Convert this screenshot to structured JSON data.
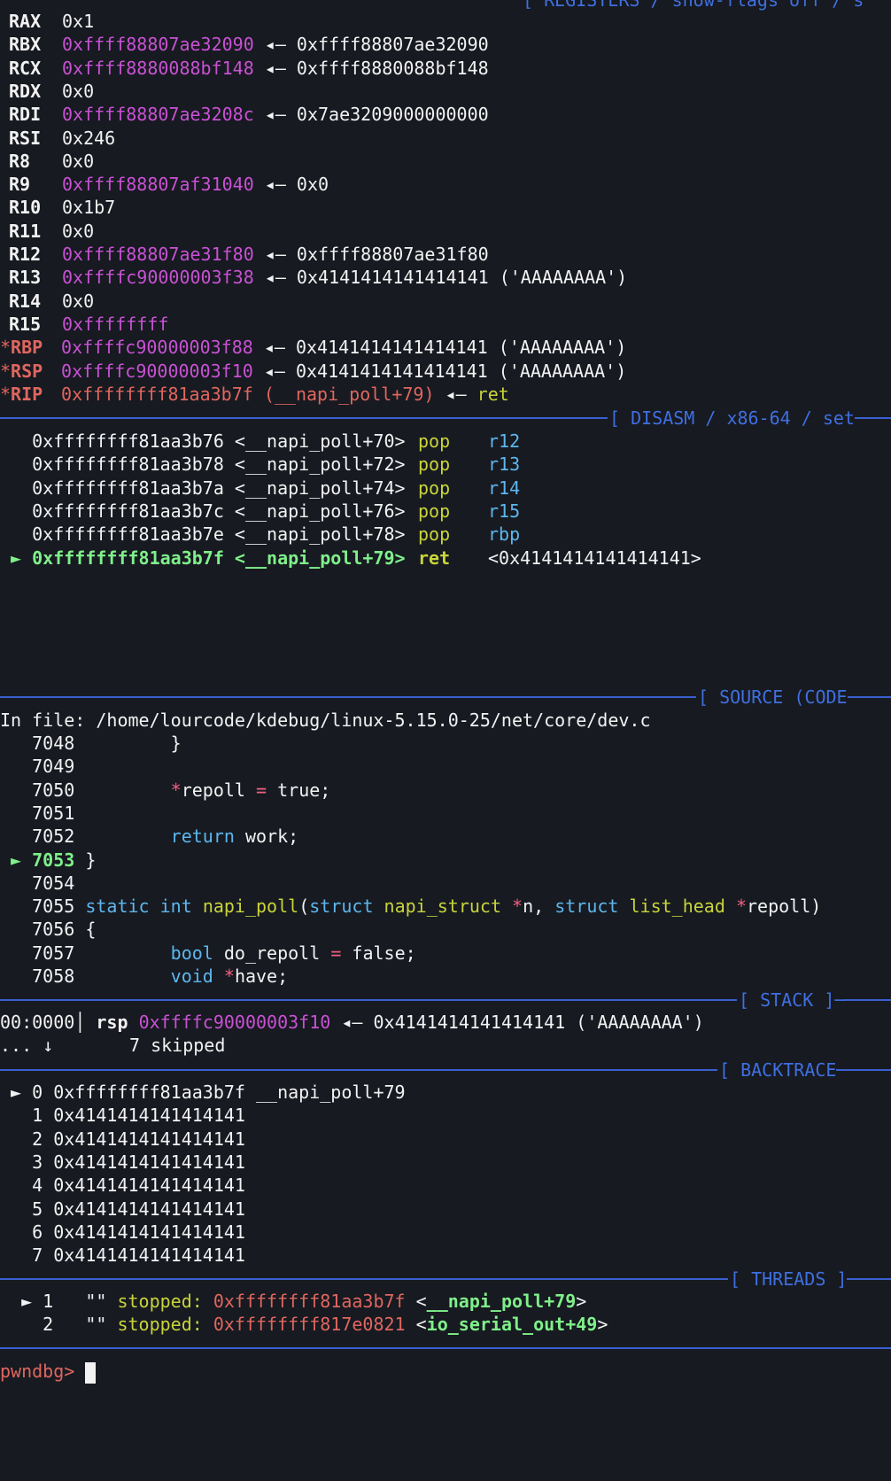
{
  "headers": {
    "registers": "[ REGISTERS / show-flags off / s",
    "disasm": "[ DISASM / x86-64 / set",
    "source": "[ SOURCE (CODE",
    "stack": "[ STACK ]─",
    "backtrace": "[ BACKTRACE",
    "threads": "[ THREADS ]"
  },
  "registers": [
    {
      "name": "RAX",
      "value": "0x1",
      "arrow": "",
      "target": "",
      "note": ""
    },
    {
      "name": "RBX",
      "value": "0xffff88807ae32090",
      "arrow": "◂—",
      "target": "0xffff88807ae32090",
      "note": ""
    },
    {
      "name": "RCX",
      "value": "0xffff8880088bf148",
      "arrow": "◂—",
      "target": "0xffff8880088bf148",
      "note": ""
    },
    {
      "name": "RDX",
      "value": "0x0",
      "arrow": "",
      "target": "",
      "note": ""
    },
    {
      "name": "RDI",
      "value": "0xffff88807ae3208c",
      "arrow": "◂—",
      "target": "0x7ae3209000000000",
      "note": ""
    },
    {
      "name": "RSI",
      "value": "0x246",
      "arrow": "",
      "target": "",
      "note": ""
    },
    {
      "name": "R8",
      "value": "0x0",
      "arrow": "",
      "target": "",
      "note": ""
    },
    {
      "name": "R9",
      "value": "0xffff88807af31040",
      "arrow": "◂—",
      "target": "0x0",
      "note": ""
    },
    {
      "name": "R10",
      "value": "0x1b7",
      "arrow": "",
      "target": "",
      "note": ""
    },
    {
      "name": "R11",
      "value": "0x0",
      "arrow": "",
      "target": "",
      "note": ""
    },
    {
      "name": "R12",
      "value": "0xffff88807ae31f80",
      "arrow": "◂—",
      "target": "0xffff88807ae31f80",
      "note": ""
    },
    {
      "name": "R13",
      "value": "0xffffc90000003f38",
      "arrow": "◂—",
      "target": "0x4141414141414141",
      "note": "('AAAAAAAA')"
    },
    {
      "name": "R14",
      "value": "0x0",
      "arrow": "",
      "target": "",
      "note": ""
    },
    {
      "name": "R15",
      "value": "0xffffffff",
      "arrow": "",
      "target": "",
      "note": ""
    },
    {
      "name": "*RBP",
      "value": "0xffffc90000003f88",
      "arrow": "◂—",
      "target": "0x4141414141414141",
      "note": "('AAAAAAAA')"
    },
    {
      "name": "*RSP",
      "value": "0xffffc90000003f10",
      "arrow": "◂—",
      "target": "0x4141414141414141",
      "note": "('AAAAAAAA')"
    },
    {
      "name": "*RIP",
      "value": "0xffffffff81aa3b7f (__napi_poll+79)",
      "arrow": "◂—",
      "target": "ret",
      "note": ""
    }
  ],
  "disasm": [
    {
      "marker": "",
      "addr": "0xffffffff81aa3b76",
      "sym": "<__napi_poll+70>",
      "mn": "pop",
      "op": "r12"
    },
    {
      "marker": "",
      "addr": "0xffffffff81aa3b78",
      "sym": "<__napi_poll+72>",
      "mn": "pop",
      "op": "r13"
    },
    {
      "marker": "",
      "addr": "0xffffffff81aa3b7a",
      "sym": "<__napi_poll+74>",
      "mn": "pop",
      "op": "r14"
    },
    {
      "marker": "",
      "addr": "0xffffffff81aa3b7c",
      "sym": "<__napi_poll+76>",
      "mn": "pop",
      "op": "r15"
    },
    {
      "marker": "",
      "addr": "0xffffffff81aa3b7e",
      "sym": "<__napi_poll+78>",
      "mn": "pop",
      "op": "rbp"
    },
    {
      "marker": "►",
      "addr": "0xffffffff81aa3b7f",
      "sym": "<__napi_poll+79>",
      "mn": "ret",
      "op": "<0x4141414141414141>"
    }
  ],
  "source": {
    "file_line": "In file: /home/lourcode/kdebug/linux-5.15.0-25/net/core/dev.c",
    "lines": [
      {
        "n": "7048",
        "text": "        }"
      },
      {
        "n": "7049",
        "text": ""
      },
      {
        "n": "7050",
        "text": "        *repoll = true;"
      },
      {
        "n": "7051",
        "text": ""
      },
      {
        "n": "7052",
        "text": "        return work;"
      },
      {
        "n": "7053",
        "text": "}",
        "current": true
      },
      {
        "n": "7054",
        "text": ""
      },
      {
        "n": "7055",
        "text": "static int napi_poll(struct napi_struct *n, struct list_head *repoll)"
      },
      {
        "n": "7056",
        "text": "{"
      },
      {
        "n": "7057",
        "text": "        bool do_repoll = false;"
      },
      {
        "n": "7058",
        "text": "        void *have;"
      }
    ]
  },
  "stack": {
    "offset": "00:0000",
    "reg": "rsp",
    "addr": "0xffffc90000003f10",
    "arrow": "◂—",
    "target": "0x4141414141414141",
    "note": "('AAAAAAAA')",
    "skip_prefix": "... ↓",
    "skip_text": "7 skipped"
  },
  "backtrace": [
    {
      "marker": "►",
      "idx": "0",
      "addr": "0xffffffff81aa3b7f",
      "sym": "__napi_poll+79"
    },
    {
      "marker": "",
      "idx": "1",
      "addr": "0x4141414141414141",
      "sym": ""
    },
    {
      "marker": "",
      "idx": "2",
      "addr": "0x4141414141414141",
      "sym": ""
    },
    {
      "marker": "",
      "idx": "3",
      "addr": "0x4141414141414141",
      "sym": ""
    },
    {
      "marker": "",
      "idx": "4",
      "addr": "0x4141414141414141",
      "sym": ""
    },
    {
      "marker": "",
      "idx": "5",
      "addr": "0x4141414141414141",
      "sym": ""
    },
    {
      "marker": "",
      "idx": "6",
      "addr": "0x4141414141414141",
      "sym": ""
    },
    {
      "marker": "",
      "idx": "7",
      "addr": "0x4141414141414141",
      "sym": ""
    }
  ],
  "threads": [
    {
      "marker": "►",
      "id": "1",
      "name": "\"\"",
      "state": "stopped:",
      "addr": "0xffffffff81aa3b7f",
      "sym": "__napi_poll+79"
    },
    {
      "marker": "",
      "id": "2",
      "name": "\"\"",
      "state": "stopped:",
      "addr": "0xffffffff817e0821",
      "sym": "io_serial_out+49"
    }
  ],
  "prompt": "pwndbg>"
}
